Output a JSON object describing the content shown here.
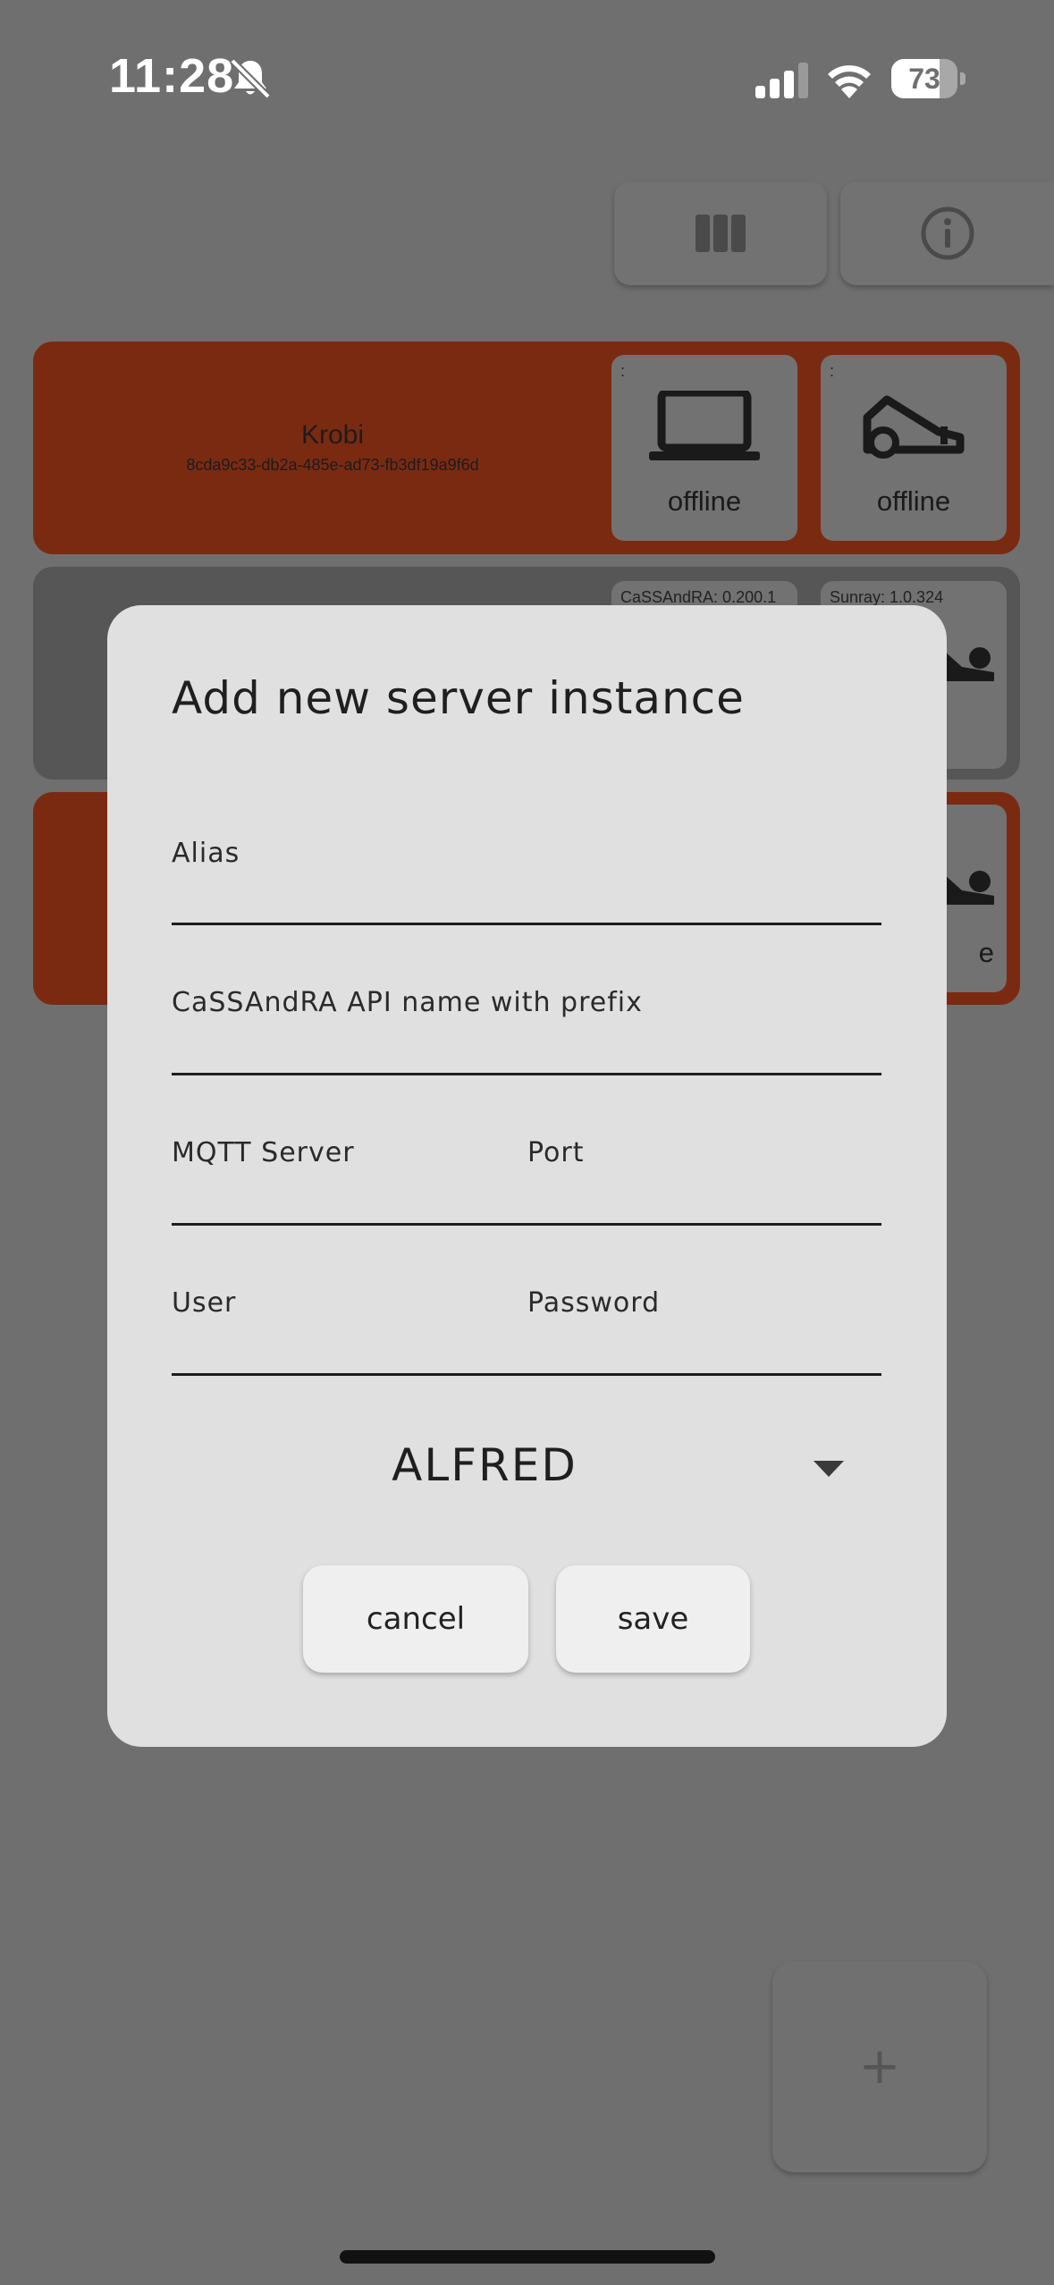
{
  "status_bar": {
    "time": "11:28",
    "battery_percent": "73",
    "battery_level": 0.73
  },
  "cards": [
    {
      "title": "Krobi",
      "subtitle": "8cda9c33-db2a-485e-ad73-fb3df19a9f6d",
      "color": "#7b2a12",
      "tiles": [
        {
          "version": ":",
          "icon": "laptop-icon",
          "status": "offline"
        },
        {
          "version": ":",
          "icon": "robot-mower-icon",
          "status": "offline"
        }
      ]
    },
    {
      "title": "",
      "color": "#565656",
      "tiles": [
        {
          "version": "CaSSAndRA: 0.200.1",
          "icon": "laptop-icon",
          "status": ""
        },
        {
          "version": "Sunray: 1.0.324",
          "icon": "robot-mower-icon",
          "status": ""
        }
      ]
    },
    {
      "title": "",
      "color": "#7b2a12",
      "tiles": [
        {
          "version": "",
          "icon": "laptop-icon",
          "status": ""
        },
        {
          "version": "",
          "icon": "robot-mower-icon",
          "status": "e"
        }
      ]
    }
  ],
  "dialog": {
    "title": "Add new server instance",
    "fields": {
      "alias": {
        "label": "Alias",
        "value": ""
      },
      "api_name": {
        "label": "CaSSAndRA API name with prefix",
        "value": ""
      },
      "mqtt_server": {
        "label": "MQTT Server",
        "value": ""
      },
      "port": {
        "label": "Port",
        "value": ""
      },
      "user": {
        "label": "User",
        "value": ""
      },
      "password": {
        "label": "Password",
        "value": ""
      }
    },
    "dropdown": {
      "selected": "ALFRED"
    },
    "buttons": {
      "cancel": "cancel",
      "save": "save"
    }
  },
  "fab": {
    "label": "+"
  },
  "colors": {
    "overlay": "#6f6f6f",
    "card_red": "#7b2a12",
    "dialog_bg": "#e0e0e0"
  }
}
